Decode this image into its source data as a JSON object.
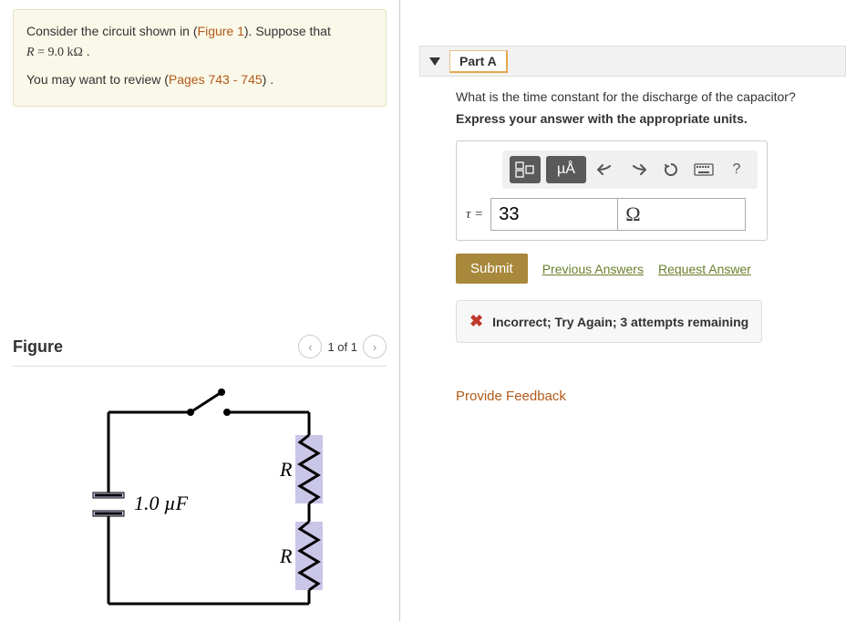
{
  "problem": {
    "intro_a": "Consider the circuit shown in (",
    "figure_link": "Figure 1",
    "intro_b": "). Suppose that ",
    "r_var": "R",
    "r_eq": " = 9.0 ",
    "r_unit": "kΩ",
    "period": " .",
    "review_a": "You may want to review (",
    "pages_link": "Pages 743 - 745",
    "review_b": ") ."
  },
  "figure": {
    "title": "Figure",
    "counter": "1 of 1",
    "cap_label": "1.0 µF",
    "r_label_top": "R",
    "r_label_bottom": "R"
  },
  "part": {
    "label": "Part A",
    "question": "What is the time constant for the discharge of the capacitor?",
    "instruction": "Express your answer with the appropriate units."
  },
  "toolbar": {
    "units_btn": "µÅ",
    "help": "?"
  },
  "answer": {
    "tau": "τ =",
    "value": "33",
    "unit": "Ω"
  },
  "actions": {
    "submit": "Submit",
    "previous": "Previous Answers",
    "request": "Request Answer"
  },
  "feedback": {
    "message": "Incorrect; Try Again; 3 attempts remaining"
  },
  "footer": {
    "provide": "Provide Feedback"
  }
}
